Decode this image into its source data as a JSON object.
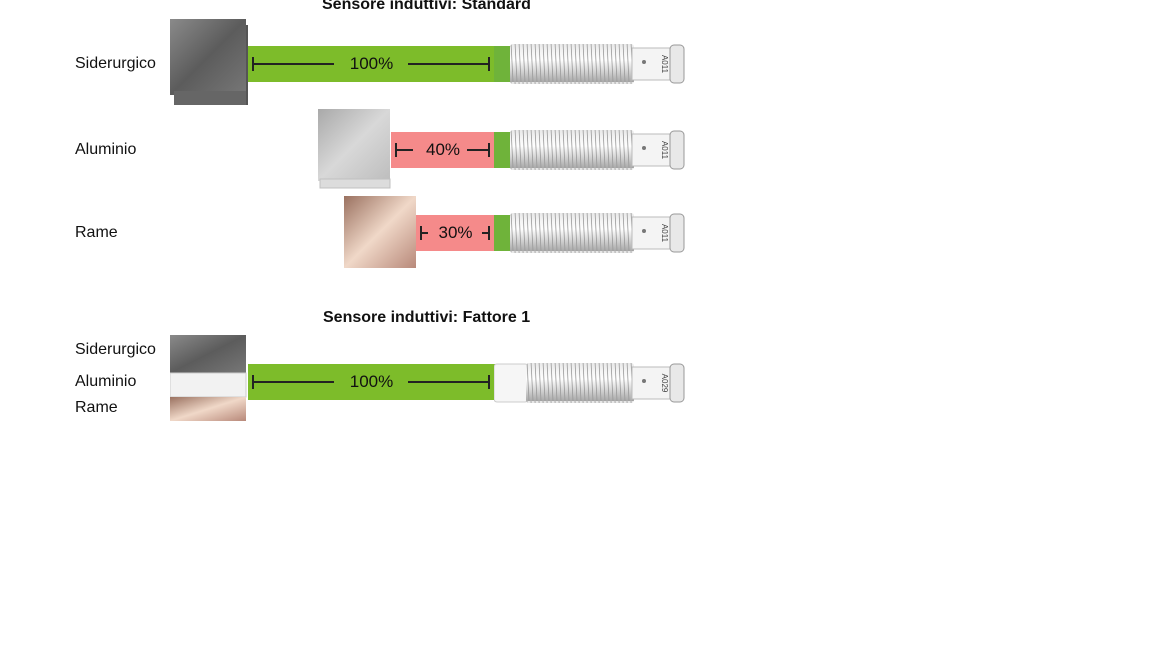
{
  "diagrams": [
    {
      "title": "Sensore induttivi: Standard",
      "rows": [
        {
          "material": "Siderurgico",
          "percent": "100%",
          "fraction": 1.0,
          "bar_color": "#7dbc2a"
        },
        {
          "material": "Aluminio",
          "percent": "40%",
          "fraction": 0.4,
          "bar_color": "#f58a8a"
        },
        {
          "material": "Rame",
          "percent": "30%",
          "fraction": 0.3,
          "bar_color": "#f58a8a"
        }
      ],
      "sensor_marking": "A011"
    },
    {
      "title": "Sensore induttivi: Fattore 1",
      "materials": [
        "Siderurgico",
        "Aluminio",
        "Rame"
      ],
      "percent": "100%",
      "fraction": 1.0,
      "bar_color": "#7dbc2a",
      "sensor_marking": "A029"
    }
  ],
  "colors": {
    "green_bar": "#7dbc2a",
    "red_bar": "#f58a8a",
    "steel": "#6e6e6e",
    "aluminium": "#c8c8c8",
    "copper": "#c79a80"
  }
}
